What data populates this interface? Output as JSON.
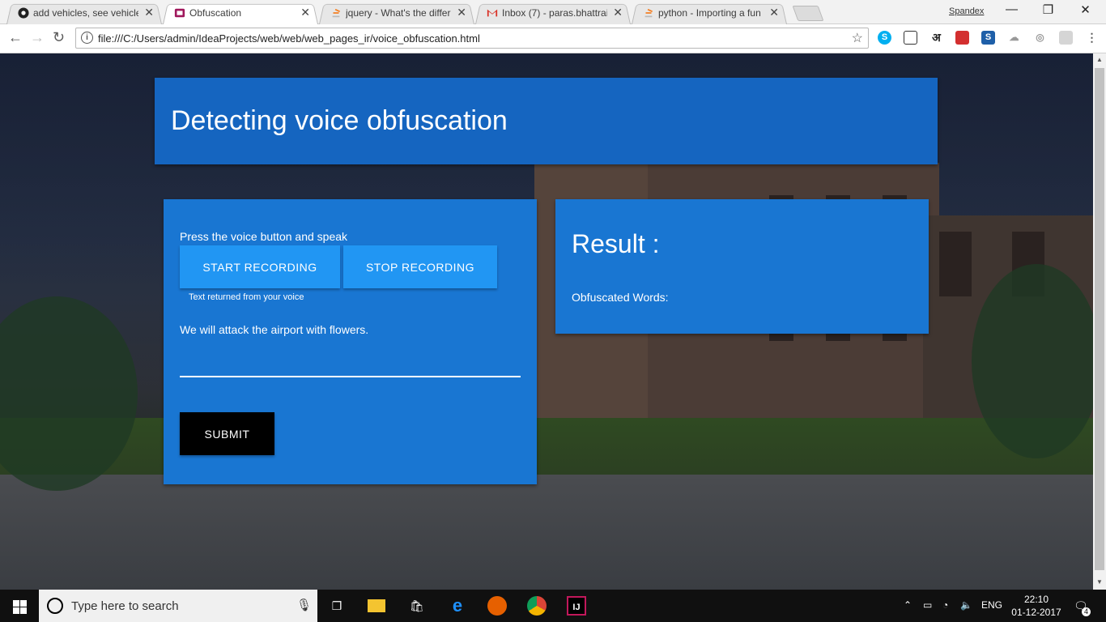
{
  "browser": {
    "tabs": [
      {
        "title": "add vehicles, see vehicles",
        "icon": "github-icon",
        "active": false
      },
      {
        "title": "Obfuscation",
        "icon": "page-icon",
        "active": true
      },
      {
        "title": "jquery - What's the differ",
        "icon": "stackoverflow-icon",
        "active": false
      },
      {
        "title": "Inbox (7) - paras.bhattrai",
        "icon": "gmail-icon",
        "active": false
      },
      {
        "title": "python - Importing a fun",
        "icon": "stackoverflow-icon",
        "active": false
      }
    ],
    "profile_name": "Spandex",
    "address": "file:///C:/Users/admin/IdeaProjects/web/web/web_pages_ir/voice_obfuscation.html",
    "extensions": [
      "skype-icon",
      "screenshot-icon",
      "hindi-input-icon",
      "book-icon",
      "edit-icon",
      "cloud-icon",
      "hide-icon",
      "cast-icon",
      "menu-icon"
    ]
  },
  "page": {
    "header_title": "Detecting voice obfuscation",
    "recorder": {
      "instruction": "Press the voice button and speak",
      "start_label": "START RECORDING",
      "stop_label": "STOP RECORDING",
      "hint": "Text returned from your voice",
      "transcript": "We will attack the airport with flowers.",
      "submit_label": "SUBMIT"
    },
    "result": {
      "title": "Result :",
      "obfuscated_label": "Obfuscated Words:"
    }
  },
  "taskbar": {
    "search_placeholder": "Type here to search",
    "apps": [
      "task-view-icon",
      "file-explorer-icon",
      "store-icon",
      "edge-icon",
      "firefox-icon",
      "chrome-icon",
      "intellij-icon"
    ],
    "language": "ENG",
    "time": "22:10",
    "date": "01-12-2017",
    "notifications": "4"
  },
  "colors": {
    "header_card": "#1565c0",
    "panel": "#1976d2",
    "button_blue": "#2196f3",
    "button_black": "#000000"
  }
}
